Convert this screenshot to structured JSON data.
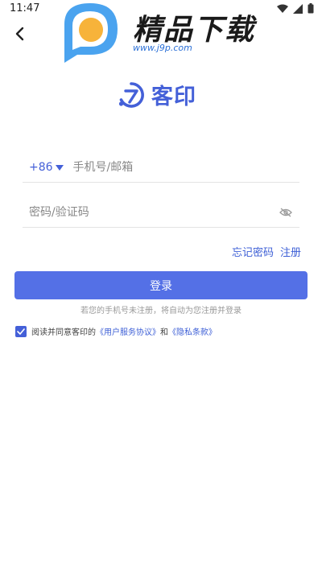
{
  "status_bar": {
    "time": "11:47"
  },
  "watermark": {
    "title": "精品下载",
    "url": "www.j9p.com"
  },
  "brand": {
    "name": "客印",
    "accent": "#4460d8"
  },
  "phone_field": {
    "country_code": "+86",
    "placeholder": "手机号/邮箱"
  },
  "code_field": {
    "placeholder": "密码/验证码"
  },
  "links": {
    "forgot": "忘记密码",
    "register": "注册"
  },
  "login_button": {
    "label": "登录",
    "color": "#5470e6"
  },
  "hint": "若您的手机号未注册，将自动为您注册并登录",
  "agreement": {
    "checked": true,
    "prefix": "阅读并同意客印的",
    "user_agreement": "《用户服务协议》",
    "connector": "和",
    "privacy": "《隐私条款》"
  }
}
